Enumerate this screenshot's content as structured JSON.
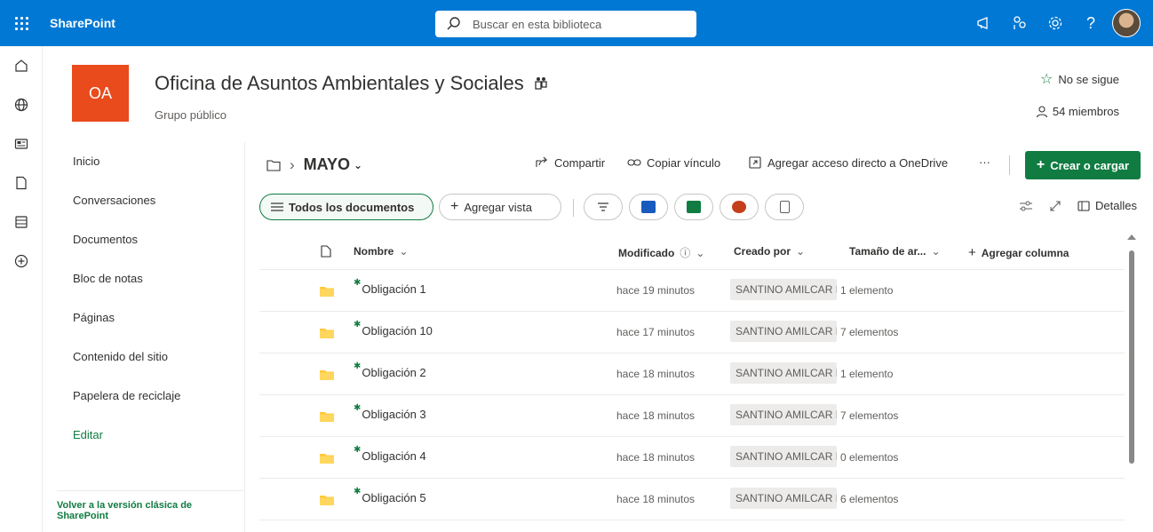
{
  "suitebar": {
    "brand": "SharePoint",
    "search_placeholder": "Buscar en esta biblioteca"
  },
  "site": {
    "logo_initials": "OA",
    "title": "Oficina de Asuntos Ambientales y Sociales",
    "subtitle": "Grupo público",
    "follow_label": "No se sigue",
    "members_label": "54 miembros",
    "logo_color": "#e94b1c"
  },
  "nav": {
    "items": [
      "Inicio",
      "Conversaciones",
      "Documentos",
      "Bloc de notas",
      "Páginas",
      "Contenido del sitio",
      "Papelera de reciclaje"
    ],
    "edit_label": "Editar",
    "classic_link": "Volver a la versión clásica de SharePoint"
  },
  "command": {
    "current_folder": "MAYO",
    "share": "Compartir",
    "copy_link": "Copiar vínculo",
    "shortcut": "Agregar acceso directo a OneDrive",
    "more": "···",
    "create": "Crear o cargar"
  },
  "views": {
    "active_view": "Todos los documentos",
    "add_view": "Agregar vista",
    "details": "Detalles"
  },
  "table": {
    "columns": {
      "name": "Nombre",
      "modified": "Modificado",
      "created_by": "Creado por",
      "size": "Tamaño de ar...",
      "add_column": "Agregar columna"
    },
    "rows": [
      {
        "name": "Obligación 1",
        "modified": "hace 19 minutos",
        "created_by": "SANTINO AMILCAR FI",
        "size": "1 elemento"
      },
      {
        "name": "Obligación 10",
        "modified": "hace 17 minutos",
        "created_by": "SANTINO AMILCAR FI",
        "size": "7 elementos"
      },
      {
        "name": "Obligación 2",
        "modified": "hace 18 minutos",
        "created_by": "SANTINO AMILCAR FI",
        "size": "1 elemento"
      },
      {
        "name": "Obligación 3",
        "modified": "hace 18 minutos",
        "created_by": "SANTINO AMILCAR FI",
        "size": "7 elementos"
      },
      {
        "name": "Obligación 4",
        "modified": "hace 18 minutos",
        "created_by": "SANTINO AMILCAR FI",
        "size": "0 elementos"
      },
      {
        "name": "Obligación 5",
        "modified": "hace 18 minutos",
        "created_by": "SANTINO AMILCAR FI",
        "size": "6 elementos"
      }
    ]
  },
  "colors": {
    "suitebar": "#0078d4",
    "accent": "#107c41",
    "folder": "#ffc83d"
  }
}
